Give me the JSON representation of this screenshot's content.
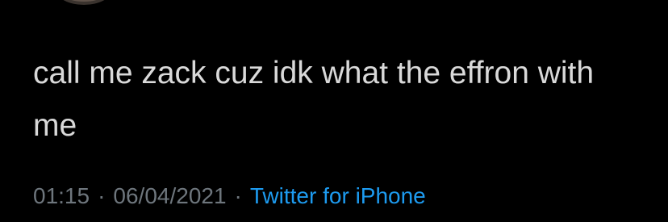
{
  "tweet": {
    "text": "call me zack cuz idk what the effron with me",
    "time": "01:15",
    "date": "06/04/2021",
    "separator": "·",
    "source": "Twitter for iPhone"
  },
  "theme": {
    "background": "#000000",
    "text": "#d9d9d9",
    "muted": "#6e767d",
    "link": "#1d9bf0"
  }
}
